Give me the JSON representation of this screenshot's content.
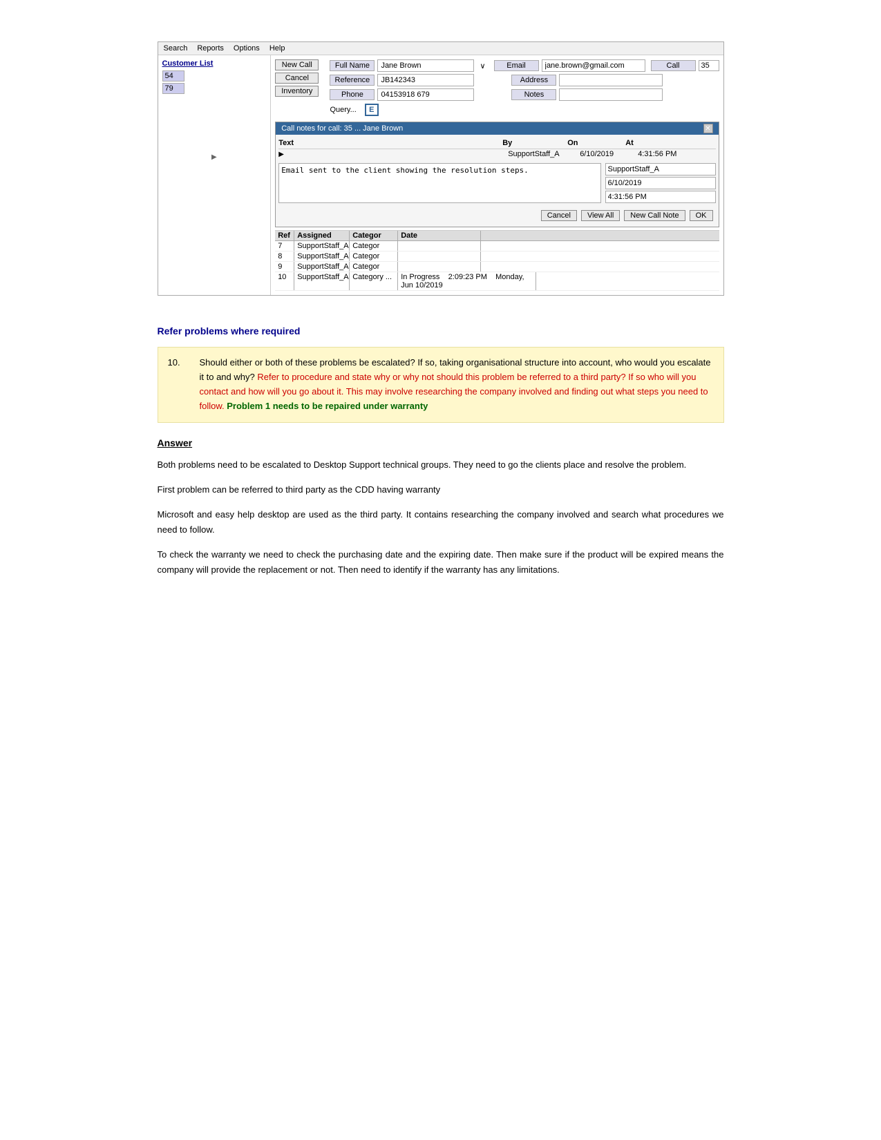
{
  "menu": {
    "items": [
      "Search",
      "Reports",
      "Options",
      "Help"
    ]
  },
  "crm": {
    "customer_list_label": "Customer List",
    "customer_ids": [
      "54",
      "79"
    ],
    "buttons": {
      "new_call": "New Call",
      "cancel": "Cancel",
      "inventory": "Inventory"
    },
    "form": {
      "full_name_label": "Full Name",
      "full_name_value": "Jane Brown",
      "email_label": "Email",
      "email_value": "jane.brown@gmail.com",
      "call_label": "Call",
      "call_value": "35",
      "reference_label": "Reference",
      "reference_value": "JB142343",
      "address_label": "Address",
      "phone_label": "Phone",
      "phone_value": "04153918 679",
      "notes_label": "Notes"
    },
    "modal": {
      "title": "Call notes for call: 35 ... Jane Brown",
      "table_headers": [
        "Text",
        "By",
        "On",
        "At"
      ],
      "row": {
        "by": "SupportStaff_A",
        "on": "6/10/2019",
        "at": "4:31:56 PM"
      },
      "note_text": "Email sent to the client showing the resolution steps.",
      "note_by": "SupportStaff_A",
      "note_date": "6/10/2019",
      "note_time": "4:31:56 PM",
      "buttons": {
        "cancel": "Cancel",
        "view_all": "View All",
        "new_call_note": "New Call Note",
        "ok": "OK"
      }
    },
    "bottom_table": {
      "headers": [
        "Ref",
        "Assigned",
        "Categor",
        "Date"
      ],
      "rows": [
        {
          "ref": "7",
          "assigned": "SupportStaff_A",
          "category": "Categor",
          "date": ""
        },
        {
          "ref": "8",
          "assigned": "SupportStaff_A",
          "category": "Categor",
          "date": ""
        },
        {
          "ref": "9",
          "assigned": "SupportStaff_A",
          "category": "Categor",
          "date": ""
        },
        {
          "ref": "10",
          "assigned": "SupportStaff_A",
          "category": "Category ...",
          "date": "Monday, Jun 10/2019"
        }
      ]
    },
    "status_row": {
      "text": "In Progress",
      "time": "2:09:23 PM",
      "date": "Monday, Jun 10/2019"
    }
  },
  "section": {
    "heading": "Refer problems where required",
    "question_number": "10.",
    "question_black": "Should either or both of these problems be escalated? If so, taking organisational structure into account, who would you escalate it to and why?",
    "question_red": "Refer to procedure and state why or why not should this problem be referred to a third party? If so who will you contact and how will you go about it. This may involve researching the company involved and finding out what steps you need to follow.",
    "question_green": "Problem 1 needs to be repaired under warranty",
    "answer_heading": "Answer",
    "paragraphs": [
      "Both problems need to be escalated to Desktop Support technical groups. They need to go the clients place and resolve the problem.",
      "First problem can be referred to third party as the CDD having warranty",
      "Microsoft and easy help desktop are used as the third party. It contains researching the company involved and search what procedures we need to follow.",
      "To check the warranty we need to check the purchasing date and the expiring date. Then make sure if the product will be expired means the company will provide the replacement or not. Then need to identify if the warranty has any limitations."
    ]
  }
}
